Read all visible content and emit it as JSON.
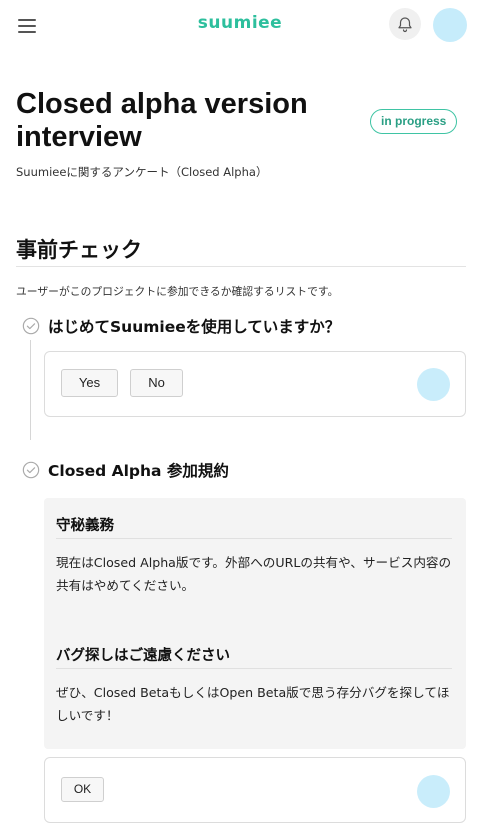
{
  "header": {
    "brand": "suumiee",
    "menu_icon": "hamburger-icon",
    "bell_icon": "bell-icon",
    "avatar_color": "#c6ecfb"
  },
  "page": {
    "title": "Closed alpha version interview",
    "status": "in progress",
    "subtitle": "Suumieeに関するアンケート（Closed Alpha）"
  },
  "section": {
    "title": "事前チェック",
    "description": "ユーザーがこのプロジェクトに参加できるか確認するリストです。"
  },
  "questions": [
    {
      "title": "はじめてSuumieeを使用していますか？",
      "options": [
        "Yes",
        "No"
      ]
    },
    {
      "title": "Closed Alpha 参加規約",
      "terms": [
        {
          "heading": "守秘義務",
          "text": "現在はClosed Alpha版です。外部へのURLの共有や、サービス内容の共有はやめてください。"
        },
        {
          "heading": "バグ探しはご遠慮ください",
          "text": "ぜひ、Closed BetaもしくはOpen Beta版で思う存分バグを探してほしいです！"
        }
      ],
      "options": [
        "OK"
      ]
    }
  ],
  "colors": {
    "accent": "#2dbf9d",
    "avatar": "#c6ecfb"
  }
}
